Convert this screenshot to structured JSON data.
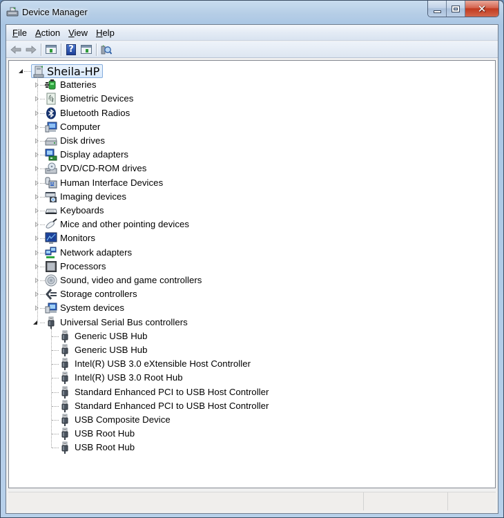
{
  "window": {
    "title": "Device Manager",
    "icon": "device-manager-icon",
    "caption_buttons": {
      "minimize": "minimize-icon",
      "maximize": "maximize-icon",
      "close": "close-icon"
    }
  },
  "menu": [
    {
      "label": "File",
      "accel": "F",
      "rest": "ile"
    },
    {
      "label": "Action",
      "accel": "A",
      "rest": "ction"
    },
    {
      "label": "View",
      "accel": "V",
      "rest": "iew"
    },
    {
      "label": "Help",
      "accel": "H",
      "rest": "elp"
    }
  ],
  "toolbar": [
    {
      "name": "back-button",
      "icon": "arrow-left-icon",
      "enabled": false
    },
    {
      "name": "forward-button",
      "icon": "arrow-right-icon",
      "enabled": false
    },
    {
      "name": "show-hide-console-tree-button",
      "icon": "console-tree-icon"
    },
    {
      "name": "help-button",
      "icon": "help-icon"
    },
    {
      "name": "show-action-pane-button",
      "icon": "action-pane-icon"
    },
    {
      "name": "scan-hardware-button",
      "icon": "scan-hardware-icon"
    }
  ],
  "tree": {
    "root": {
      "label": "Sheila-HP",
      "icon": "computer-icon",
      "expanded": true,
      "selected": true
    },
    "categories": [
      {
        "label": "Batteries",
        "icon": "battery-icon",
        "expanded": false
      },
      {
        "label": "Biometric Devices",
        "icon": "fingerprint-icon",
        "expanded": false
      },
      {
        "label": "Bluetooth Radios",
        "icon": "bluetooth-icon",
        "expanded": false
      },
      {
        "label": "Computer",
        "icon": "computer-monitor-icon",
        "expanded": false
      },
      {
        "label": "Disk drives",
        "icon": "disk-drive-icon",
        "expanded": false
      },
      {
        "label": "Display adapters",
        "icon": "display-adapter-icon",
        "expanded": false
      },
      {
        "label": "DVD/CD-ROM drives",
        "icon": "dvd-drive-icon",
        "expanded": false
      },
      {
        "label": "Human Interface Devices",
        "icon": "hid-icon",
        "expanded": false
      },
      {
        "label": "Imaging devices",
        "icon": "camera-scanner-icon",
        "expanded": false
      },
      {
        "label": "Keyboards",
        "icon": "keyboard-icon",
        "expanded": false
      },
      {
        "label": "Mice and other pointing devices",
        "icon": "mouse-icon",
        "expanded": false
      },
      {
        "label": "Monitors",
        "icon": "monitor-icon",
        "expanded": false
      },
      {
        "label": "Network adapters",
        "icon": "network-adapter-icon",
        "expanded": false
      },
      {
        "label": "Processors",
        "icon": "processor-icon",
        "expanded": false
      },
      {
        "label": "Sound, video and game controllers",
        "icon": "speaker-icon",
        "expanded": false
      },
      {
        "label": "Storage controllers",
        "icon": "storage-controller-icon",
        "expanded": false
      },
      {
        "label": "System devices",
        "icon": "system-devices-icon",
        "expanded": false
      },
      {
        "label": "Universal Serial Bus controllers",
        "icon": "usb-plug-icon",
        "expanded": true,
        "children": [
          {
            "label": "Generic USB Hub",
            "icon": "usb-plug-icon"
          },
          {
            "label": "Generic USB Hub",
            "icon": "usb-plug-icon"
          },
          {
            "label": "Intel(R) USB 3.0 eXtensible Host Controller",
            "icon": "usb-plug-icon"
          },
          {
            "label": "Intel(R) USB 3.0 Root Hub",
            "icon": "usb-plug-icon"
          },
          {
            "label": "Standard Enhanced PCI to USB Host Controller",
            "icon": "usb-plug-icon"
          },
          {
            "label": "Standard Enhanced PCI to USB Host Controller",
            "icon": "usb-plug-icon"
          },
          {
            "label": "USB Composite Device",
            "icon": "usb-plug-icon"
          },
          {
            "label": "USB Root Hub",
            "icon": "usb-plug-icon"
          },
          {
            "label": "USB Root Hub",
            "icon": "usb-plug-icon"
          }
        ]
      }
    ]
  },
  "statusbar": {
    "panes": [
      "",
      "",
      ""
    ]
  },
  "colors": {
    "selection_border": "#84acdd",
    "selection_fill": "#dceafc",
    "close_button": "#c9442b",
    "frame": "#b5cde6"
  }
}
